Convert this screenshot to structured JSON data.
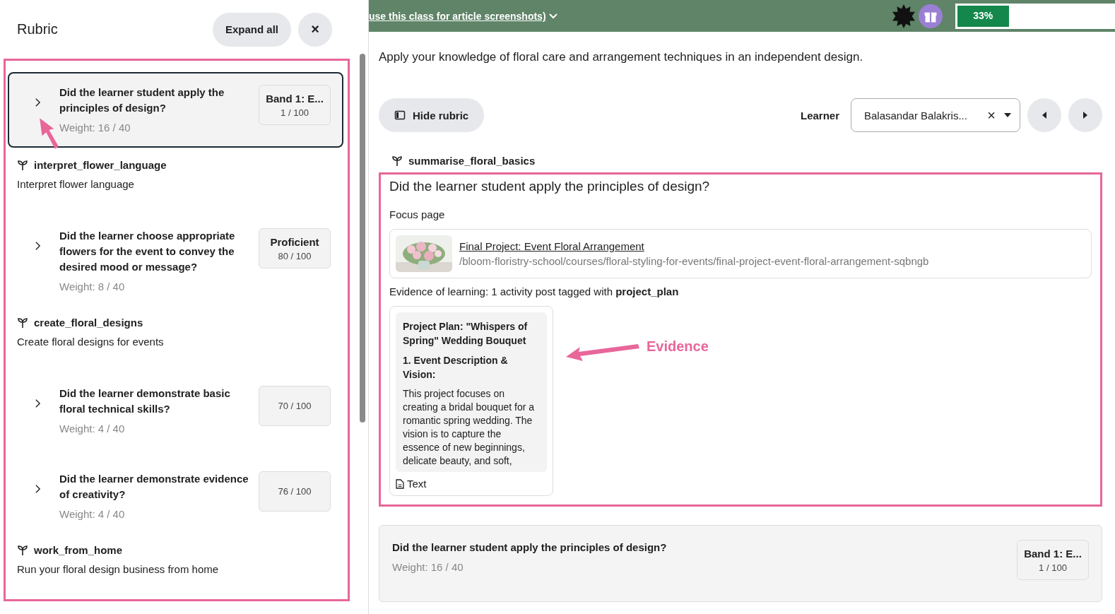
{
  "rubric": {
    "title": "Rubric",
    "expand_button": "Expand all",
    "close_button": "×",
    "items": [
      {
        "kind": "criterion",
        "question": "Did the learner student apply the principles of design?",
        "weight": "Weight: 16 / 40",
        "band": "Band 1: E...",
        "score": "1 / 100",
        "selected": true
      },
      {
        "kind": "outcome",
        "code": "interpret_flower_language",
        "description": "Interpret flower language"
      },
      {
        "kind": "criterion",
        "question": "Did the learner choose appropriate flowers for the event to convey the desired mood or message?",
        "weight": "Weight: 8 / 40",
        "band": "Proficient",
        "score": "80 / 100",
        "selected": false
      },
      {
        "kind": "outcome",
        "code": "create_floral_designs",
        "description": "Create floral designs for events"
      },
      {
        "kind": "criterion",
        "question": "Did the learner demonstrate basic floral technical skills?",
        "weight": "Weight: 4 / 40",
        "score": "70 / 100",
        "selected": false
      },
      {
        "kind": "criterion",
        "question": "Did the learner demonstrate evidence of creativity?",
        "weight": "Weight: 4 / 40",
        "score": "76 / 100",
        "selected": false
      },
      {
        "kind": "outcome",
        "code": "work_from_home",
        "description": "Run your floral design business from home"
      }
    ]
  },
  "banner": {
    "text": "use this class for article screenshots)",
    "progress": {
      "level": 0.33,
      "reading": "33%"
    }
  },
  "page": {
    "subtitle": "Apply your knowledge of floral care and arrangement techniques in an independent design.",
    "hide_rubric_button": "Hide rubric",
    "learner_label": "Learner",
    "learner_value": "Balasandar Balakris...",
    "clear": "×"
  },
  "assessment": {
    "outcome": "summarise_floral_basics",
    "question": "Did the learner student apply the principles of design?",
    "focus_label": "Focus page",
    "focus_link": {
      "title": "Final Project: Event Floral Arrangement",
      "path": "/bloom-floristry-school/courses/floral-styling-for-events/final-project-event-floral-arrangement-sqbngb"
    },
    "evidence_label": "Evidence of learning: 1 activity post tagged with **project_plan**",
    "evidence_card": {
      "title": "Project Plan: \"Whispers of Spring\" Wedding Bouquet",
      "heading": "1. Event Description & Vision:",
      "body": "This project focuses on creating a bridal bouquet for a romantic spring wedding. The vision is to capture the essence of new beginnings, delicate beauty, and soft,",
      "type": "Text"
    },
    "annotation": "Evidence"
  },
  "next_criterion": {
    "question": "Did the learner student apply the principles of design?",
    "weight": "Weight: 16 / 40",
    "band": "Band 1: E...",
    "score": "1 / 100"
  }
}
